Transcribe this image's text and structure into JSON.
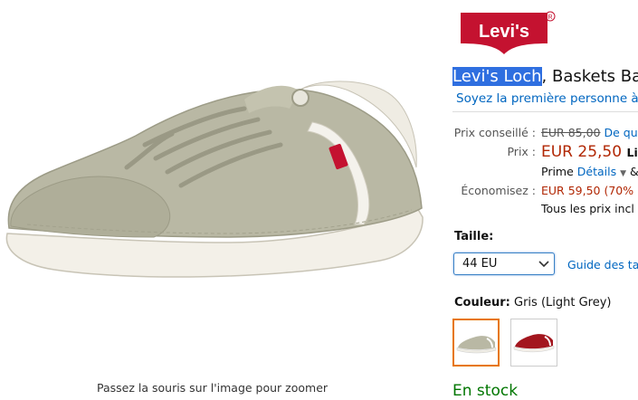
{
  "image": {
    "zoom_hint": "Passez la souris sur l'image pour zoomer"
  },
  "brand": {
    "logo_text": "Levi's",
    "logo_color": "#c41230"
  },
  "product": {
    "title_highlight": "Levi's Loch",
    "title_rest": ", Baskets Ba",
    "review_link": "Soyez la première personne à é"
  },
  "pricing": {
    "list_label": "Prix conseillé :",
    "list_value": "EUR 85,00",
    "list_extra": "De qu",
    "price_label": "Prix :",
    "price_value": "EUR 25,50",
    "price_extra": "Liv",
    "prime_text": "Prime",
    "prime_details": "Détails",
    "prime_extra": "&",
    "save_label": "Économisez :",
    "save_value": "EUR 59,50 (70%",
    "tax_note": "Tous les prix incl"
  },
  "size": {
    "label": "Taille:",
    "selected": "44 EU",
    "guide_link": "Guide des tai"
  },
  "color": {
    "label": "Couleur:",
    "value": "Gris (Light Grey)"
  },
  "stock": {
    "status": "En stock",
    "color": "#007600"
  }
}
